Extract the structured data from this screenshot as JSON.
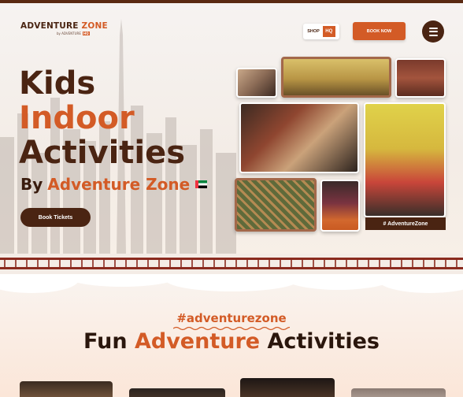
{
  "header": {
    "logo_main": "ADVENTURE",
    "logo_zone": "ZONE",
    "logo_sub": "by ADVENTURE",
    "logo_sub_badge": "HQ",
    "shop_label": "SHOP",
    "shop_badge": "HQ",
    "book_now_label": "BOOK NOW",
    "menu_icon": "hamburger-menu-icon"
  },
  "hero": {
    "title_line1": "Kids",
    "title_line2": "Indoor",
    "title_line3": "Activities",
    "subtitle_by": "By",
    "subtitle_brand": "Adventure Zone",
    "flag_icon": "uae-flag-icon",
    "cta_label": "Book Tickets",
    "hashtag_badge": "# AdventureZone"
  },
  "section": {
    "hashtag": "#adventurezone",
    "heading_part1": "Fun",
    "heading_part2": "Adventure",
    "heading_part3": "Activities"
  },
  "colors": {
    "brand_brown": "#4a2412",
    "brand_orange": "#d35b26",
    "fence_red": "#8a2a1e"
  }
}
